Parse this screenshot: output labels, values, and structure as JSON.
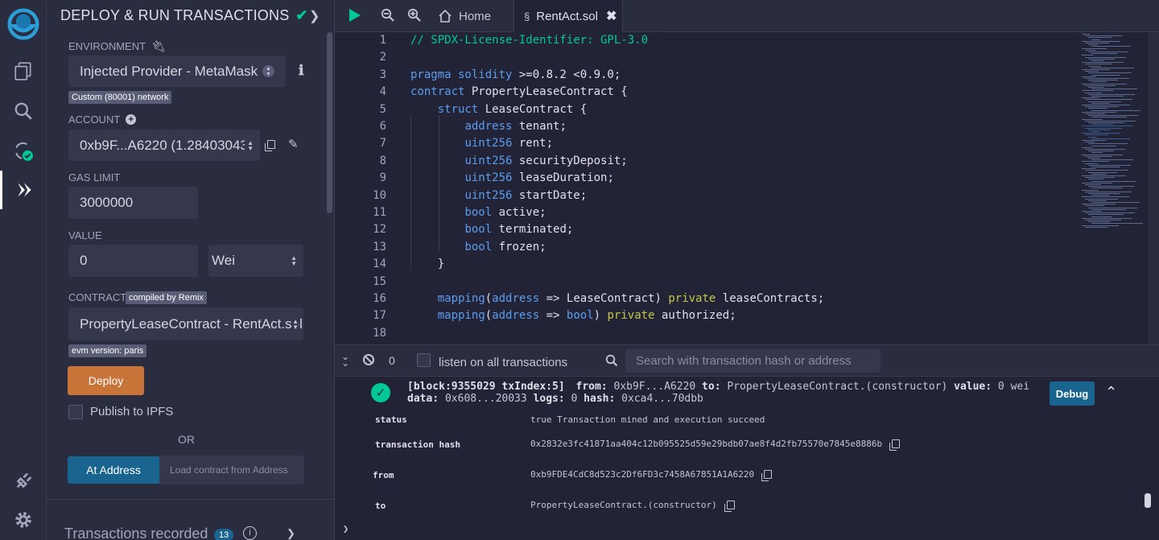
{
  "panel": {
    "title": "DEPLOY & RUN TRANSACTIONS",
    "environment_label": "ENVIRONMENT",
    "environment_value": "Injected Provider - MetaMask",
    "network_badge": "Custom (80001) network",
    "account_label": "ACCOUNT",
    "account_value": "0xb9F...A6220 (1.28403043",
    "gas_limit_label": "GAS LIMIT",
    "gas_limit_value": "3000000",
    "value_label": "VALUE",
    "value_amount": "0",
    "value_unit": "Wei",
    "contract_label": "CONTRACT",
    "compiled_badge": "compiled by Remix",
    "contract_value": "PropertyLeaseContract - RentAct.sol",
    "evm_badge": "evm version: paris",
    "deploy_label": "Deploy",
    "publish_label": "Publish to IPFS",
    "or_label": "OR",
    "at_address_label": "At Address",
    "load_contract_placeholder": "Load contract from Address",
    "tx_recorded_label": "Transactions recorded",
    "tx_recorded_count": "13"
  },
  "tabs": {
    "home": "Home",
    "rentact": "RentAct.sol"
  },
  "editor": {
    "lines": [
      {
        "n": "1",
        "parts": [
          {
            "c": "cm",
            "t": "// SPDX-License-Identifier: GPL-3.0"
          }
        ]
      },
      {
        "n": "2",
        "parts": []
      },
      {
        "n": "3",
        "parts": [
          {
            "c": "kw",
            "t": "pragma solidity "
          },
          {
            "c": "tx",
            "t": ">=0.8.2 <0.9.0;"
          }
        ]
      },
      {
        "n": "4",
        "parts": [
          {
            "c": "kw",
            "t": "contract "
          },
          {
            "c": "tx",
            "t": "PropertyLeaseContract {"
          }
        ]
      },
      {
        "n": "5",
        "parts": [
          {
            "c": "tx",
            "t": "    "
          },
          {
            "c": "kw",
            "t": "struct "
          },
          {
            "c": "tx",
            "t": "LeaseContract {"
          }
        ]
      },
      {
        "n": "6",
        "parts": [
          {
            "c": "tx",
            "t": "        "
          },
          {
            "c": "kw",
            "t": "address "
          },
          {
            "c": "tx",
            "t": "tenant;"
          }
        ]
      },
      {
        "n": "7",
        "parts": [
          {
            "c": "tx",
            "t": "        "
          },
          {
            "c": "kw",
            "t": "uint256 "
          },
          {
            "c": "tx",
            "t": "rent;"
          }
        ]
      },
      {
        "n": "8",
        "parts": [
          {
            "c": "tx",
            "t": "        "
          },
          {
            "c": "kw",
            "t": "uint256 "
          },
          {
            "c": "tx",
            "t": "securityDeposit;"
          }
        ]
      },
      {
        "n": "9",
        "parts": [
          {
            "c": "tx",
            "t": "        "
          },
          {
            "c": "kw",
            "t": "uint256 "
          },
          {
            "c": "tx",
            "t": "leaseDuration;"
          }
        ]
      },
      {
        "n": "10",
        "parts": [
          {
            "c": "tx",
            "t": "        "
          },
          {
            "c": "kw",
            "t": "uint256 "
          },
          {
            "c": "tx",
            "t": "startDate;"
          }
        ]
      },
      {
        "n": "11",
        "parts": [
          {
            "c": "tx",
            "t": "        "
          },
          {
            "c": "kw",
            "t": "bool "
          },
          {
            "c": "tx",
            "t": "active;"
          }
        ]
      },
      {
        "n": "12",
        "parts": [
          {
            "c": "tx",
            "t": "        "
          },
          {
            "c": "kw",
            "t": "bool "
          },
          {
            "c": "tx",
            "t": "terminated;"
          }
        ]
      },
      {
        "n": "13",
        "parts": [
          {
            "c": "tx",
            "t": "        "
          },
          {
            "c": "kw",
            "t": "bool "
          },
          {
            "c": "tx",
            "t": "frozen;"
          }
        ]
      },
      {
        "n": "14",
        "parts": [
          {
            "c": "tx",
            "t": "    }"
          }
        ]
      },
      {
        "n": "15",
        "parts": []
      },
      {
        "n": "16",
        "parts": [
          {
            "c": "tx",
            "t": "    "
          },
          {
            "c": "kw",
            "t": "mapping"
          },
          {
            "c": "tx",
            "t": "("
          },
          {
            "c": "kw",
            "t": "address"
          },
          {
            "c": "tx",
            "t": " => LeaseContract) "
          },
          {
            "c": "ex",
            "t": "private"
          },
          {
            "c": "tx",
            "t": " leaseContracts;"
          }
        ]
      },
      {
        "n": "17",
        "parts": [
          {
            "c": "tx",
            "t": "    "
          },
          {
            "c": "kw",
            "t": "mapping"
          },
          {
            "c": "tx",
            "t": "("
          },
          {
            "c": "kw",
            "t": "address"
          },
          {
            "c": "tx",
            "t": " => "
          },
          {
            "c": "kw",
            "t": "bool"
          },
          {
            "c": "tx",
            "t": ") "
          },
          {
            "c": "ex",
            "t": "private"
          },
          {
            "c": "tx",
            "t": " authorized;"
          }
        ]
      },
      {
        "n": "18",
        "parts": []
      }
    ]
  },
  "terminal": {
    "pending_count": "0",
    "listen_label": "listen on all transactions",
    "search_placeholder": "Search with transaction hash or address",
    "log_line1_prefix": "[block:9355029 txIndex:5]",
    "log_line1_from_key": "from:",
    "log_line1_from_val": "0xb9F...A6220",
    "log_line1_to_key": "to:",
    "log_line1_to_val": "PropertyLeaseContract.(constructor)",
    "log_line1_value_key": "value:",
    "log_line1_value_val": "0 wei",
    "log_line2_data_key": "data:",
    "log_line2_data_val": "0x608...20033",
    "log_line2_logs_key": "logs:",
    "log_line2_logs_val": "0",
    "log_line2_hash_key": "hash:",
    "log_line2_hash_val": "0xca4...70dbb",
    "debug_label": "Debug",
    "rows": {
      "status_key": "status",
      "status_val": "true Transaction mined and execution succeed",
      "hash_key": "transaction hash",
      "hash_val": "0x2832e3fc41871aa404c12b095525d59e29bdb07ae8f4d2fb75570e7845e8886b",
      "from_key": "from",
      "from_val": "0xb9FDE4CdC8d523c2Df6FD3c7458A67851A1A6220",
      "to_key": "to",
      "to_val": "PropertyLeaseContract.(constructor)"
    }
  },
  "colors": {
    "accent_blue": "#1a6490",
    "deploy_orange": "#c97539",
    "success_green": "#00c897"
  }
}
